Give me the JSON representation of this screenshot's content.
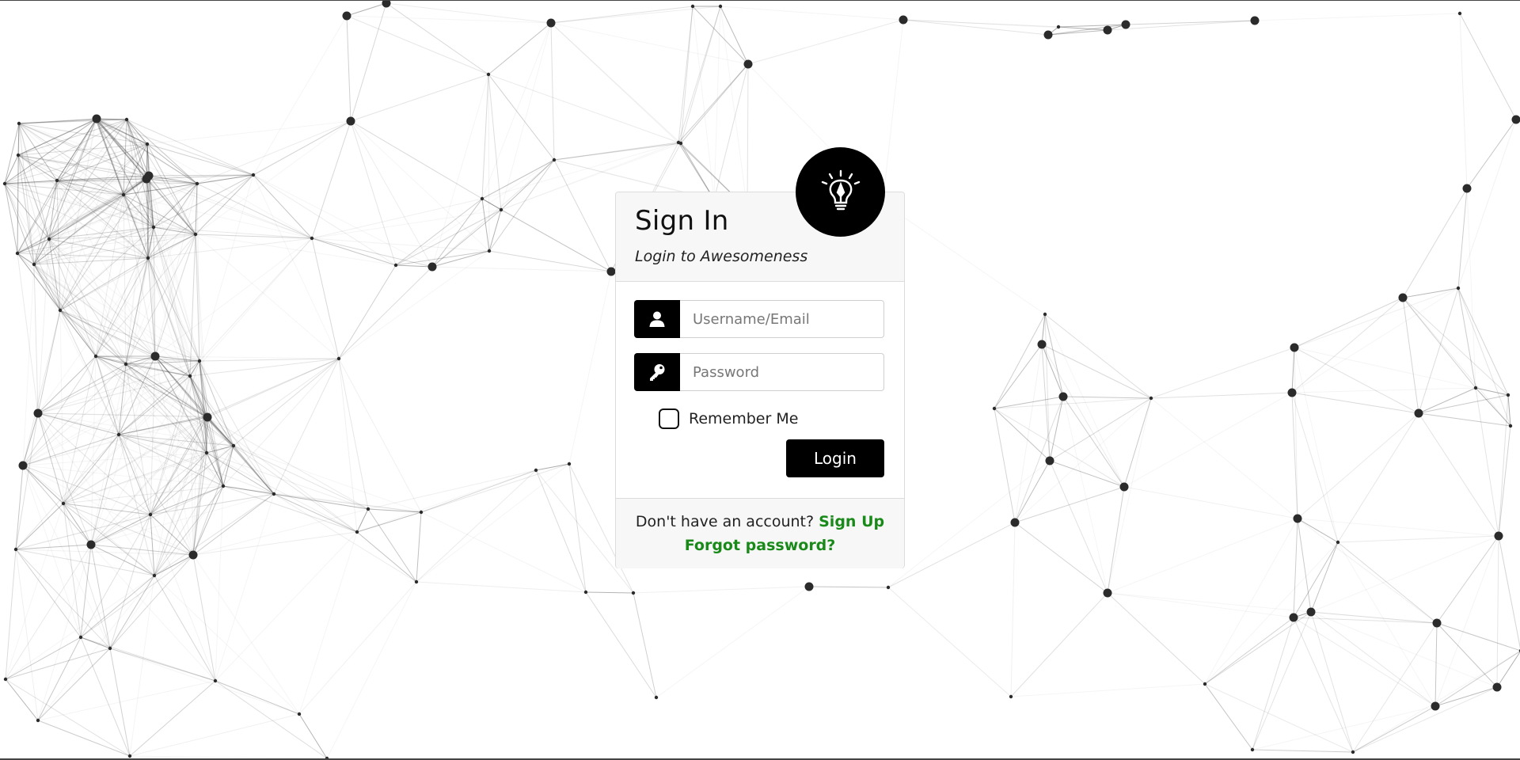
{
  "header": {
    "title": "Sign In",
    "subtitle": "Login to Awesomeness"
  },
  "logo": {
    "icon": "lightbulb-pen-icon"
  },
  "form": {
    "username_placeholder": "Username/Email",
    "username_value": "",
    "username_icon": "user-icon",
    "password_placeholder": "Password",
    "password_value": "",
    "password_icon": "key-icon",
    "remember_label": "Remember Me",
    "remember_checked": false,
    "login_label": "Login"
  },
  "footer": {
    "signup_prompt": "Don't have an account?",
    "signup_link": "Sign Up",
    "forgot_link": "Forgot password?"
  },
  "colors": {
    "accent": "#000000",
    "link": "#198a19",
    "header_bg": "#f7f7f7"
  }
}
